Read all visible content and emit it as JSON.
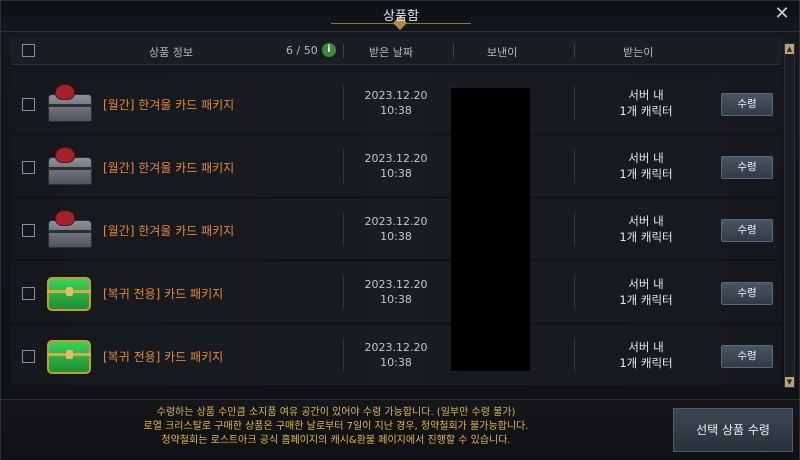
{
  "window": {
    "title": "상품함",
    "close_glyph": "✕"
  },
  "header": {
    "col_item_info": "상품 정보",
    "count": "6 / 50",
    "info_glyph": "i",
    "col_received_date": "받은 날짜",
    "col_sender": "보낸이",
    "col_recipient": "받는이"
  },
  "rows": [
    {
      "icon": "silver-chest-icon",
      "name": "[월간] 한겨울 카드 패키지",
      "date": "2023.12.20",
      "time": "10:38",
      "recipient_line1": "서버 내",
      "recipient_line2": "1개 캐릭터",
      "button": "수령"
    },
    {
      "icon": "silver-chest-icon",
      "name": "[월간] 한겨울 카드 패키지",
      "date": "2023.12.20",
      "time": "10:38",
      "recipient_line1": "서버 내",
      "recipient_line2": "1개 캐릭터",
      "button": "수령"
    },
    {
      "icon": "silver-chest-icon",
      "name": "[월간] 한겨울 카드 패키지",
      "date": "2023.12.20",
      "time": "10:38",
      "recipient_line1": "서버 내",
      "recipient_line2": "1개 캐릭터",
      "button": "수령"
    },
    {
      "icon": "green-chest-icon",
      "name": "[복귀 전용] 카드 패키지",
      "date": "2023.12.20",
      "time": "10:38",
      "recipient_line1": "서버 내",
      "recipient_line2": "1개 캐릭터",
      "button": "수령"
    },
    {
      "icon": "green-chest-icon",
      "name": "[복귀 전용] 카드 패키지",
      "date": "2023.12.20",
      "time": "10:38",
      "recipient_line1": "서버 내",
      "recipient_line2": "1개 캐릭터",
      "button": "수령"
    }
  ],
  "footer": {
    "notice_line1": "수령하는 상품 수만큼 소지품 여유 공간이 있어야 수령 가능합니다. (일부만 수령 불가)",
    "notice_line2": "로열 크리스탈로 구매한 상품은 구매한 날로부터 7일이 지난 경우, 청약철회가 불가능합니다.",
    "notice_line3": "청약철회는 로스트아크 공식 홈페이지의 캐시&환불 페이지에서 진행할 수 있습니다.",
    "bulk_button": "선택 상품 수령"
  },
  "scrollbar": {
    "up_glyph": "▲",
    "down_glyph": "▼"
  }
}
